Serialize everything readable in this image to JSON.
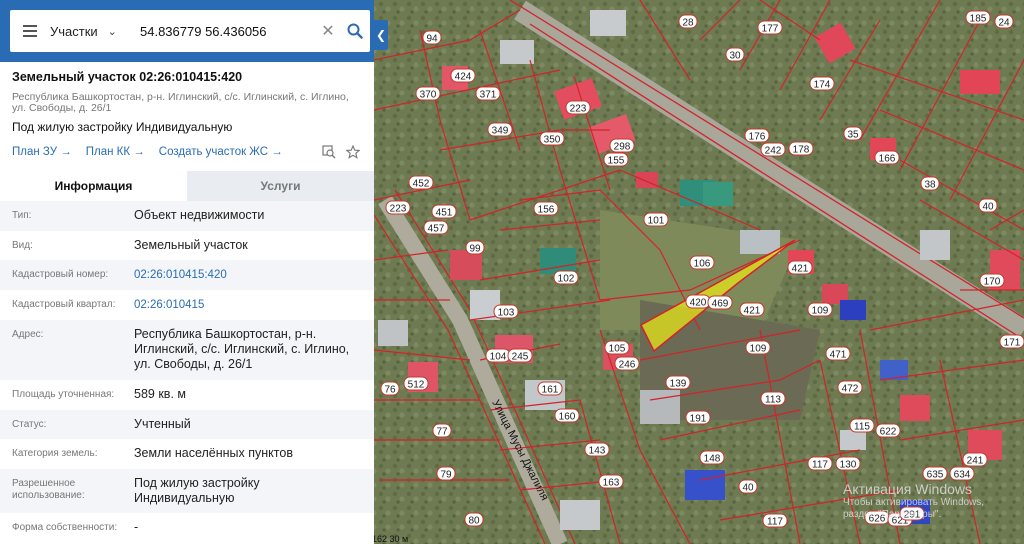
{
  "search": {
    "type_label": "Участки",
    "query": "54.836779 56.436056"
  },
  "object": {
    "title": "Земельный участок 02:26:010415:420",
    "address_line": "Республика Башкортостан, р-н. Иглинский, с/с. Иглинский, с. Иглино, ул. Свободы, д. 26/1",
    "use": "Под жилую застройку Индивидуальную",
    "links": [
      "План ЗУ →",
      "План КК →",
      "Создать участок ЖС →"
    ]
  },
  "tabs": {
    "info": "Информация",
    "services": "Услуги"
  },
  "properties": [
    {
      "key": "Тип:",
      "value": "Объект недвижимости"
    },
    {
      "key": "Вид:",
      "value": "Земельный участок"
    },
    {
      "key": "Кадастровый номер:",
      "value": "02:26:010415:420"
    },
    {
      "key": "Кадастровый квартал:",
      "value": "02:26:010415"
    },
    {
      "key": "Адрес:",
      "value": "Республика Башкортостан, р-н. Иглинский, с/с. Иглинский, с. Иглино, ул. Свободы, д. 26/1"
    },
    {
      "key": "Площадь уточненная:",
      "value": "589 кв. м"
    },
    {
      "key": "Статус:",
      "value": "Учтенный"
    },
    {
      "key": "Категория земель:",
      "value": "Земли населённых пунктов"
    },
    {
      "key": "Разрешенное использование:",
      "value": "Под жилую застройку Индивидуальную"
    },
    {
      "key": "Форма собственности:",
      "value": "-"
    }
  ],
  "map": {
    "street": "Улица Мусы Джалиля",
    "parcel_labels": [
      "94",
      "28",
      "30",
      "177",
      "185",
      "24",
      "424",
      "370",
      "371",
      "223",
      "174",
      "349",
      "350",
      "298",
      "155",
      "35",
      "166",
      "176",
      "242",
      "178",
      "452",
      "223",
      "451",
      "457",
      "156",
      "101",
      "38",
      "40",
      "99",
      "106",
      "421",
      "102",
      "420",
      "469",
      "421",
      "109",
      "170",
      "103",
      "105",
      "246",
      "109",
      "104",
      "245",
      "471",
      "171",
      "161",
      "139",
      "472",
      "76",
      "512",
      "160",
      "191",
      "115",
      "622",
      "77",
      "143",
      "148",
      "113",
      "117",
      "130",
      "79",
      "163",
      "40",
      "635",
      "634",
      "80",
      "117",
      "626",
      "621",
      "291",
      "241"
    ],
    "colors": {
      "parcel_border": "#d2232a",
      "highlight": "#e6e619",
      "road_border": "#d2232a"
    }
  },
  "watermark": {
    "title": "Активация Windows",
    "line1": "Чтобы активировать Windows,",
    "line2": "раздел \"Параметры\"."
  }
}
